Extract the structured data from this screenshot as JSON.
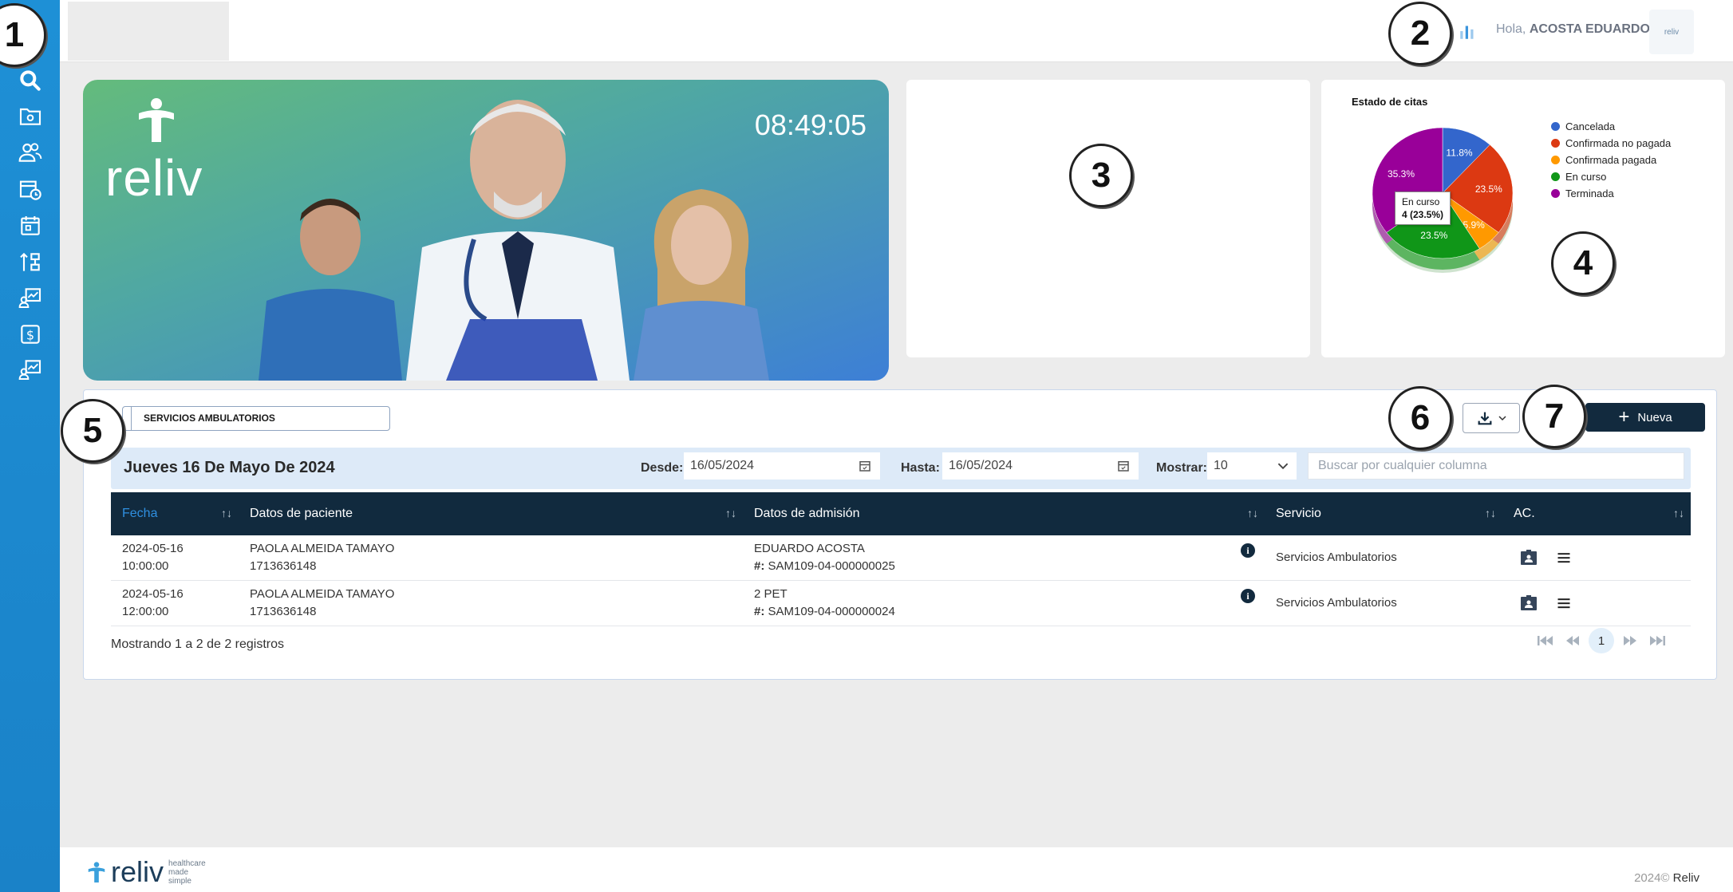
{
  "callouts": [
    "1",
    "2",
    "3",
    "4",
    "5",
    "6",
    "7"
  ],
  "sidebar": {
    "items": [
      {
        "name": "search-icon"
      },
      {
        "name": "folder-settings-icon"
      },
      {
        "name": "users-icon"
      },
      {
        "name": "calendar-clock-icon"
      },
      {
        "name": "calendar-icon"
      },
      {
        "name": "hierarchy-icon"
      },
      {
        "name": "chart-user-icon"
      },
      {
        "name": "dollar-icon"
      },
      {
        "name": "report-user-icon"
      }
    ]
  },
  "header": {
    "greeting": "Hola,",
    "user_name": "ACOSTA EDUARDO",
    "logo_text": "reliv"
  },
  "hero": {
    "brand": "reliv",
    "clock": "08:49:05"
  },
  "pie": {
    "title": "Estado de citas",
    "tooltip_label": "En curso",
    "tooltip_value": "4 (23.5%)"
  },
  "chart_data": {
    "type": "pie",
    "title": "Estado de citas",
    "series": [
      {
        "name": "Cancelada",
        "value": 2,
        "percent": 11.8,
        "color": "#3366cc"
      },
      {
        "name": "Confirmada no pagada",
        "value": 4,
        "percent": 23.5,
        "color": "#dc3912"
      },
      {
        "name": "Confirmada pagada",
        "value": 1,
        "percent": 5.9,
        "color": "#ff9900"
      },
      {
        "name": "En curso",
        "value": 4,
        "percent": 23.5,
        "color": "#109618"
      },
      {
        "name": "Terminada",
        "value": 6,
        "percent": 35.3,
        "color": "#990099"
      }
    ],
    "legend": "right"
  },
  "panel": {
    "tab_label": "SERVICIOS AMBULATORIOS",
    "new_label": "Nueva",
    "date_title": "Jueves 16 De Mayo De 2024",
    "desde_label": "Desde:",
    "desde_value": "16/05/2024",
    "hasta_label": "Hasta:",
    "hasta_value": "16/05/2024",
    "mostrar_label": "Mostrar:",
    "mostrar_value": "10",
    "search_placeholder": "Buscar por cualquier columna",
    "columns": [
      "Fecha",
      "Datos de paciente",
      "Datos de admisión",
      "Servicio",
      "AC."
    ],
    "rows": [
      {
        "date": "2024-05-16",
        "time": "10:00:00",
        "patient": "PAOLA ALMEIDA TAMAYO",
        "patient_id": "1713636148",
        "admit_name": "EDUARDO ACOSTA",
        "admit_prefix": "#:",
        "admit_code": "SAM109-04-000000025",
        "service": "Servicios Ambulatorios"
      },
      {
        "date": "2024-05-16",
        "time": "12:00:00",
        "patient": "PAOLA ALMEIDA TAMAYO",
        "patient_id": "1713636148",
        "admit_name": "2 PET",
        "admit_prefix": "#:",
        "admit_code": "SAM109-04-000000024",
        "service": "Servicios Ambulatorios"
      }
    ],
    "records_text": "Mostrando 1 a 2 de 2 registros",
    "page": "1"
  },
  "footer": {
    "brand": "reliv",
    "tagline": [
      "healthcare",
      "made",
      "simple"
    ],
    "year": "2024©",
    "company": "Reliv"
  }
}
